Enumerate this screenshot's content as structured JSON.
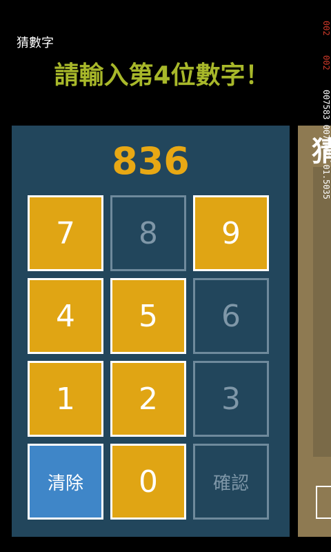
{
  "app": {
    "title": "猜數字",
    "prompt": "請輸入第4位數字！"
  },
  "display": {
    "value": "836"
  },
  "keypad": [
    {
      "label": "7",
      "state": "on",
      "name": "key-7-button"
    },
    {
      "label": "8",
      "state": "off",
      "name": "key-8-button"
    },
    {
      "label": "9",
      "state": "on",
      "name": "key-9-button"
    },
    {
      "label": "4",
      "state": "on",
      "name": "key-4-button"
    },
    {
      "label": "5",
      "state": "on",
      "name": "key-5-button"
    },
    {
      "label": "6",
      "state": "off",
      "name": "key-6-button"
    },
    {
      "label": "1",
      "state": "on",
      "name": "key-1-button"
    },
    {
      "label": "2",
      "state": "on",
      "name": "key-2-button"
    },
    {
      "label": "3",
      "state": "off",
      "name": "key-3-button"
    },
    {
      "label": "清除",
      "state": "clear",
      "name": "clear-button"
    },
    {
      "label": "0",
      "state": "on",
      "name": "key-0-button"
    },
    {
      "label": "確認",
      "state": "confirm",
      "name": "confirm-button"
    }
  ],
  "peek_panel": {
    "title_fragment": "猜"
  },
  "debug_overlay": {
    "line1": "002",
    "line2": "002",
    "line3": "007583 007 001 01.5035"
  },
  "colors": {
    "background": "#000000",
    "prompt": "#a8b82a",
    "panel": "#22465c",
    "accent": "#e0a514",
    "clear": "#3f86c8",
    "disabled_text": "#7f97a8"
  }
}
